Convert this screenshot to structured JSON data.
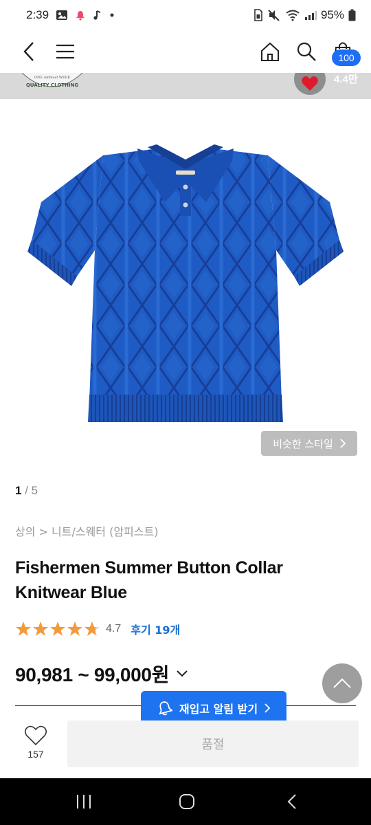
{
  "status_bar": {
    "time": "2:39",
    "battery": "95%",
    "left_icons": [
      "gallery-icon",
      "bell-notification-icon",
      "music-note-icon",
      "dot-icon"
    ],
    "right_icons": [
      "sim-icon",
      "mute-icon",
      "wifi-icon",
      "signal-icon",
      "battery-icon"
    ]
  },
  "nav": {
    "cart_count": "100",
    "icons": [
      "back-icon",
      "menu-icon",
      "home-icon",
      "search-icon",
      "cart-icon"
    ]
  },
  "banner": {
    "logo_text_top": "ONE Amfeast WEEK",
    "logo_text_bottom": "QUALITY CLOTHING",
    "like_count": "4.4만"
  },
  "product": {
    "similar_style_label": "비슷한 스타일",
    "pager_current": "1",
    "pager_separator": "/",
    "pager_total": "5",
    "breadcrumb": "상의 > 니트/스웨터 (암피스트)",
    "title_line1": "Fishermen Summer Button Collar",
    "title_line2": "Knitwear Blue",
    "rating": "4.7",
    "rating_value": 4.7,
    "review_label": "후기 19개",
    "price": "90,981 ~ 99,000원"
  },
  "bottom": {
    "restock_label": "재입고 알림 받기",
    "wish_count": "157",
    "soldout_label": "품절"
  },
  "colors": {
    "accent": "#1d73f0",
    "star": "#f59a3b",
    "knit_blue": "#1f5bc4",
    "review": "#1b6fd0"
  }
}
